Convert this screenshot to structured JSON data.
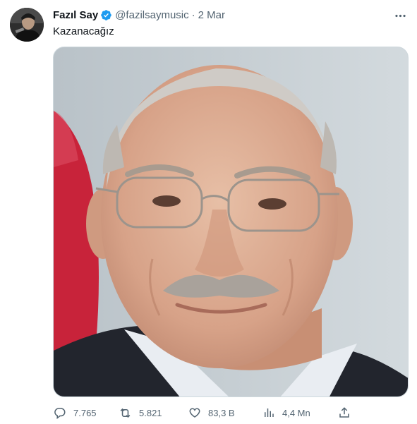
{
  "tweet": {
    "author_name": "Fazıl Say",
    "handle": "@fazilsaymusic",
    "separator": "·",
    "date": "2 Mar",
    "text": "Kazanacağız",
    "avatar_icon": "profile-photo",
    "verified_icon": "verified-badge-icon",
    "more_icon": "more-options-icon",
    "media": {
      "description_icon": "portrait-photo"
    },
    "actions": {
      "reply_count": "7.765",
      "retweet_count": "5.821",
      "like_count": "83,3 B",
      "views_count": "4,4 Mn"
    }
  },
  "colors": {
    "text_primary": "#0f1419",
    "text_secondary": "#536471",
    "verified_blue": "#1d9bf0",
    "border": "#cfd9de"
  }
}
